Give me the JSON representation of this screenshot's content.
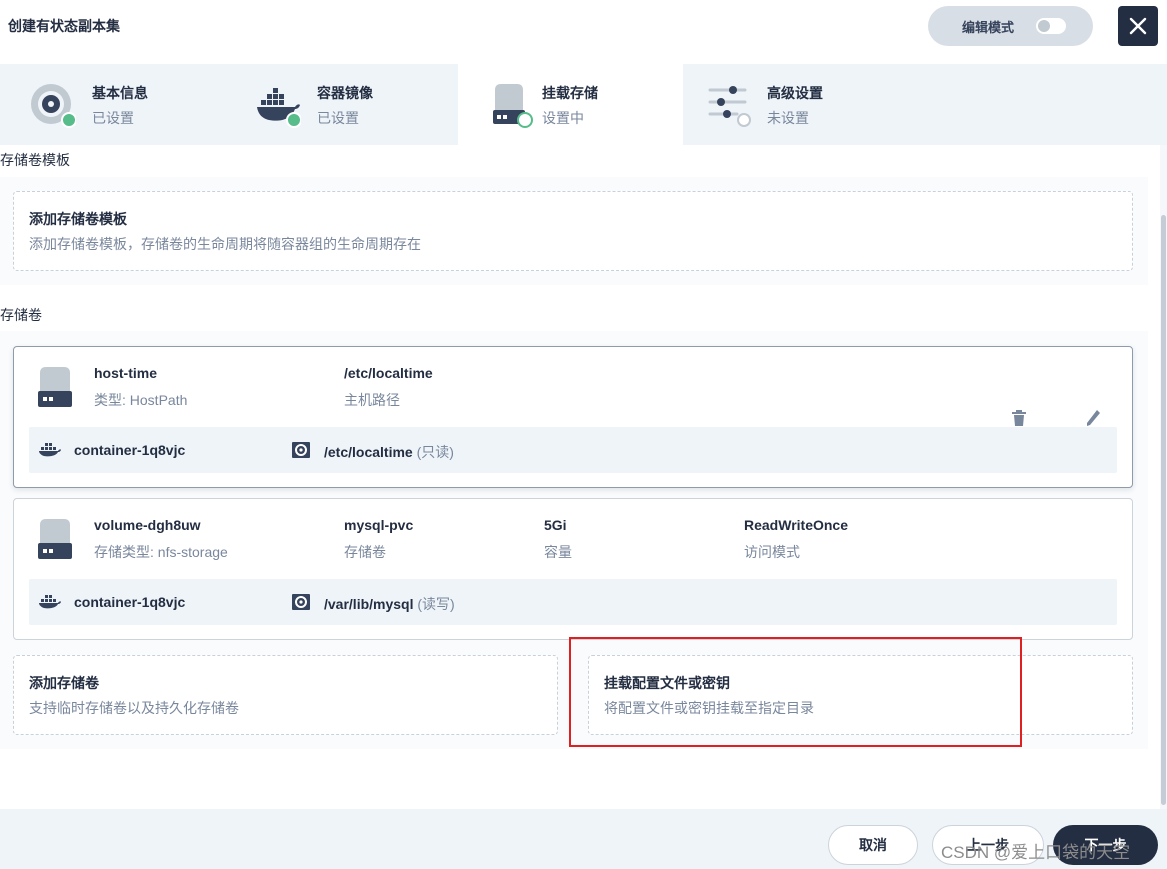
{
  "header": {
    "title": "创建有状态副本集",
    "edit_mode_label": "编辑模式"
  },
  "steps": [
    {
      "name": "基本信息",
      "status": "已设置",
      "icon": "disc-icon"
    },
    {
      "name": "容器镜像",
      "status": "已设置",
      "icon": "docker-icon"
    },
    {
      "name": "挂载存储",
      "status": "设置中",
      "icon": "storage-icon"
    },
    {
      "name": "高级设置",
      "status": "未设置",
      "icon": "sliders-icon"
    }
  ],
  "template_section": {
    "label": "存储卷模板",
    "add_title": "添加存储卷模板",
    "add_desc": "添加存储卷模板，存储卷的生命周期将随容器组的生命周期存在"
  },
  "volumes_section": {
    "label": "存储卷",
    "volumes": [
      {
        "name": "host-time",
        "type": "类型: HostPath",
        "path": "/etc/localtime",
        "path_label": "主机路径",
        "container": "container-1q8vjc",
        "mount_path": "/etc/localtime",
        "mount_mode": "(只读)"
      },
      {
        "name": "volume-dgh8uw",
        "type": "存储类型: nfs-storage",
        "pvc": "mysql-pvc",
        "pvc_label": "存储卷",
        "capacity": "5Gi",
        "capacity_label": "容量",
        "access": "ReadWriteOnce",
        "access_label": "访问模式",
        "container": "container-1q8vjc",
        "mount_path": "/var/lib/mysql",
        "mount_mode": "(读写)"
      }
    ],
    "add_volume_title": "添加存储卷",
    "add_volume_desc": "支持临时存储卷以及持久化存储卷",
    "mount_config_title": "挂载配置文件或密钥",
    "mount_config_desc": "将配置文件或密钥挂载至指定目录"
  },
  "footer": {
    "cancel": "取消",
    "prev": "上一步",
    "next": "下一步",
    "watermark": "CSDN @爱上口袋的天空"
  },
  "colors": {
    "dark": "#242e42",
    "muted": "#79879c",
    "success": "#55bc8a",
    "highlight": "#e02020"
  }
}
